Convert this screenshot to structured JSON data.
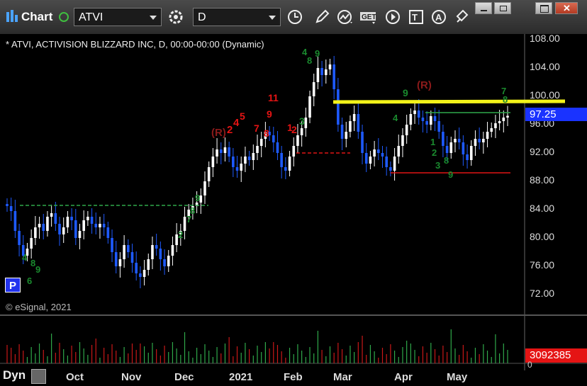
{
  "toolbar": {
    "title": "Chart",
    "symbol_input": "ATVI",
    "interval_input": "D",
    "icons": [
      "chart-logo-icon",
      "link-status-icon",
      "settings-gear-icon",
      "clock-icon",
      "pencil-draw-icon",
      "indicator-icon",
      "get-data-icon",
      "play-icon",
      "text-tool-icon",
      "alert-icon",
      "cursor-tool-icon",
      "minimize-icon",
      "restore-icon",
      "maximize-icon",
      "close-icon"
    ]
  },
  "chart": {
    "symbol_line": "* ATVI, ACTIVISION BLIZZARD INC, D, 00:00-00:00 (Dynamic)",
    "copyright": "© eSignal, 2021",
    "price_labels": [
      "108.00",
      "104.00",
      "100.00",
      "96.00",
      "92.00",
      "88.00",
      "84.00",
      "80.00",
      "76.00",
      "72.00"
    ],
    "current_price": "97.25",
    "current_volume": "3092385",
    "volume_zero": "0",
    "p_button": "P",
    "dyn_label": "Dyn",
    "months": [
      "Oct",
      "Nov",
      "Dec",
      "2021",
      "Feb",
      "Mar",
      "Apr",
      "May"
    ]
  },
  "chart_data": {
    "type": "candlestick",
    "title": "* ATVI, ACTIVISION BLIZZARD INC, D, 00:00-00:00 (Dynamic)",
    "ylim": [
      70,
      110
    ],
    "y_ticks": [
      72,
      76,
      80,
      84,
      88,
      92,
      96,
      100,
      104,
      108
    ],
    "x_ticks": [
      "Oct",
      "Nov",
      "Dec",
      "2021",
      "Feb",
      "Mar",
      "Apr",
      "May"
    ],
    "series": [
      {
        "close": [
          84.5,
          83.8,
          81,
          79,
          77.5,
          78.5,
          80,
          81.5,
          82,
          81,
          83,
          83.5,
          82,
          80.5,
          81.5,
          83,
          82.5,
          80,
          81,
          82.5,
          83,
          82,
          81.5,
          82,
          81.5,
          80,
          78,
          76,
          77,
          79,
          78,
          76.5,
          75,
          74.5,
          75.5,
          77,
          79,
          78.5,
          77,
          76,
          77.5,
          79,
          80.5,
          81,
          83,
          84,
          84.5,
          85,
          86,
          88,
          90,
          91.5,
          92.5,
          92,
          92.8,
          91.5,
          90,
          89.5,
          90.5,
          91.5,
          91,
          92,
          93,
          94,
          95,
          94.5,
          93.5,
          92,
          90,
          89.5,
          91.5,
          93,
          94.5,
          95.5,
          97,
          100,
          102,
          104,
          103,
          103.8,
          104.5,
          101,
          96,
          94,
          95,
          96.5,
          97.5,
          95,
          92,
          90.5,
          91.5,
          92.5,
          92,
          91.5,
          90,
          89.5,
          91.5,
          93,
          94.5,
          96,
          97.5,
          98,
          97,
          96.5,
          96,
          97.2,
          96.5,
          95,
          93,
          92,
          93.5,
          94,
          93.5,
          91.8,
          91,
          93,
          94,
          93.5,
          94,
          95,
          95.5,
          96.2,
          96.5,
          97,
          97.25
        ]
      }
    ],
    "volume_last": 3092385,
    "annotations": {
      "yellow_trendline": [
        [
          97.6,
          99.3
        ],
        [
          99.5,
          99.0
        ]
      ],
      "green_level_lines": [
        84.5,
        97.6
      ],
      "red_level_lines": [
        91.8,
        89.0
      ],
      "sequential_counts_text": [
        "(R)",
        "(R)",
        "11",
        "9",
        "8",
        "7",
        "5",
        "4",
        "2",
        "1",
        "4",
        "8",
        "9",
        "9",
        "7",
        "8",
        "1",
        "2",
        "3",
        "4",
        "5",
        "6",
        "7",
        "8",
        "9"
      ]
    },
    "colors": {
      "up": "#ffffff",
      "down": "#1e5aff",
      "yellow": "#f3f31a",
      "green": "#2fa84a",
      "red": "#e01414",
      "annot_green": "#1a8a2e",
      "annot_red": "#e51414"
    }
  }
}
